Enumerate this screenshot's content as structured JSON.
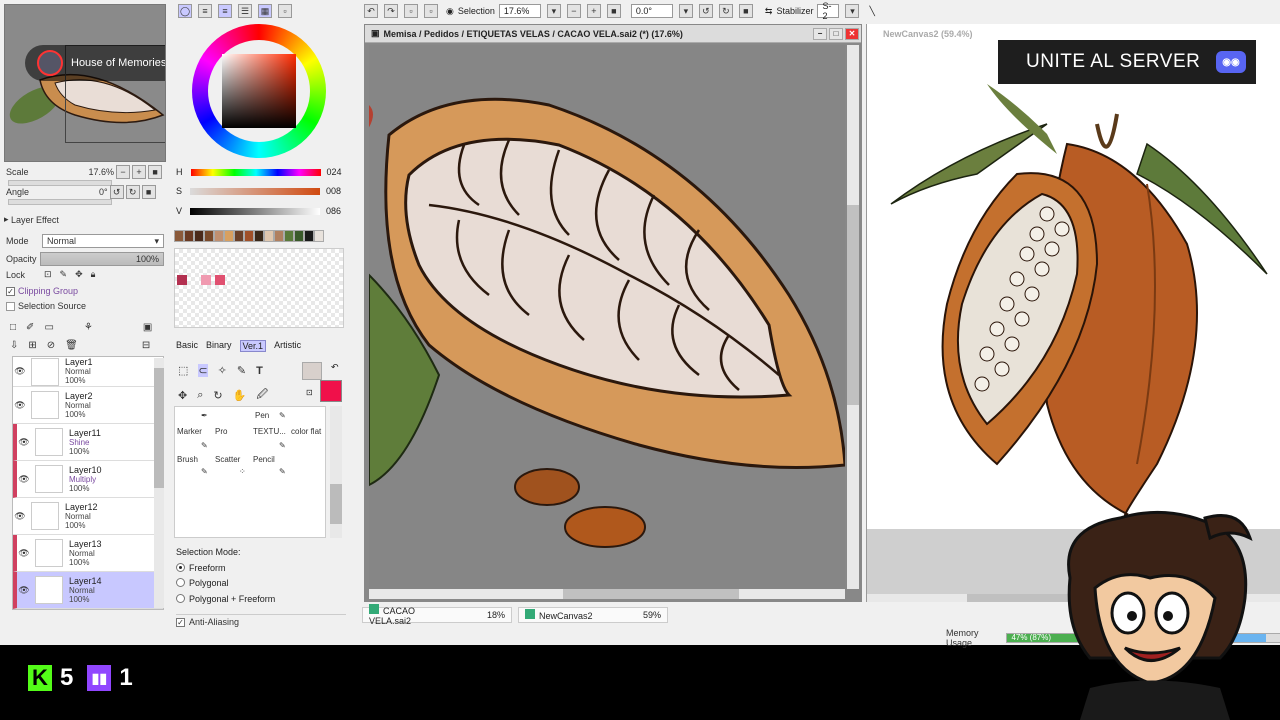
{
  "navigator": {
    "overlay_name": "House of Memories"
  },
  "view": {
    "scale_label": "Scale",
    "scale_value": "17.6%",
    "angle_label": "Angle",
    "angle_value": "0°"
  },
  "layer_effect": {
    "header": "Layer Effect",
    "mode_label": "Mode",
    "mode_value": "Normal",
    "opacity_label": "Opacity",
    "opacity_value": "100%",
    "lock_label": "Lock",
    "clipping_group": "Clipping Group",
    "selection_source": "Selection Source"
  },
  "layers": [
    {
      "name": "Layer1",
      "mode": "Normal",
      "opacity": "100%"
    },
    {
      "name": "Layer2",
      "mode": "Normal",
      "opacity": "100%"
    },
    {
      "name": "Layer11",
      "mode": "Shine",
      "opacity": "100%"
    },
    {
      "name": "Layer10",
      "mode": "Multiply",
      "opacity": "100%"
    },
    {
      "name": "Layer12",
      "mode": "Normal",
      "opacity": "100%"
    },
    {
      "name": "Layer13",
      "mode": "Normal",
      "opacity": "100%"
    },
    {
      "name": "Layer14",
      "mode": "Normal",
      "opacity": "100%"
    }
  ],
  "hsv": {
    "h_label": "H",
    "h": "024",
    "s_label": "S",
    "s": "008",
    "v_label": "V",
    "v": "086"
  },
  "tool_tabs": [
    "Basic",
    "Binary",
    "Ver.1",
    "Artistic"
  ],
  "tools": {
    "pen": "Pen",
    "marker": "Marker",
    "pro": "Pro",
    "textu": "TEXTU...",
    "color_flat": "color flat",
    "brush": "Brush",
    "scatter": "Scatter",
    "pencil": "Pencil"
  },
  "selection_mode": {
    "label": "Selection Mode:",
    "options": [
      "Freeform",
      "Polygonal",
      "Polygonal + Freeform"
    ],
    "selected": "Freeform",
    "anti_aliasing": "Anti-Aliasing"
  },
  "toolbar": {
    "selection_label": "Selection",
    "zoom_value": "17.6%",
    "angle_value": "0.0°",
    "stabilizer_label": "Stabilizer",
    "stabilizer_value": "S-2"
  },
  "canvas": {
    "title": "Memisa / Pedidos / ETIQUETAS VELAS / CACAO VELA.sai2 (*) (17.6%)"
  },
  "reference": {
    "title": "NewCanvas2 (59.4%)"
  },
  "doc_tabs": [
    {
      "name": "CACAO VELA.sai2",
      "zoom": "18%"
    },
    {
      "name": "NewCanvas2",
      "zoom": "59%"
    }
  ],
  "memory": {
    "label": "Memory Usage",
    "value": "47% (87%)",
    "fraction": 0.47
  },
  "discord_banner": {
    "text": "UNITE AL SERVER"
  },
  "counters": {
    "kick": "5",
    "twitch": "1"
  },
  "colors": {
    "accent_selected": "#c8c8ff",
    "clip_marker": "#d04060",
    "kick": "#53fc18",
    "twitch": "#9146ff",
    "discord": "#5865f2"
  }
}
